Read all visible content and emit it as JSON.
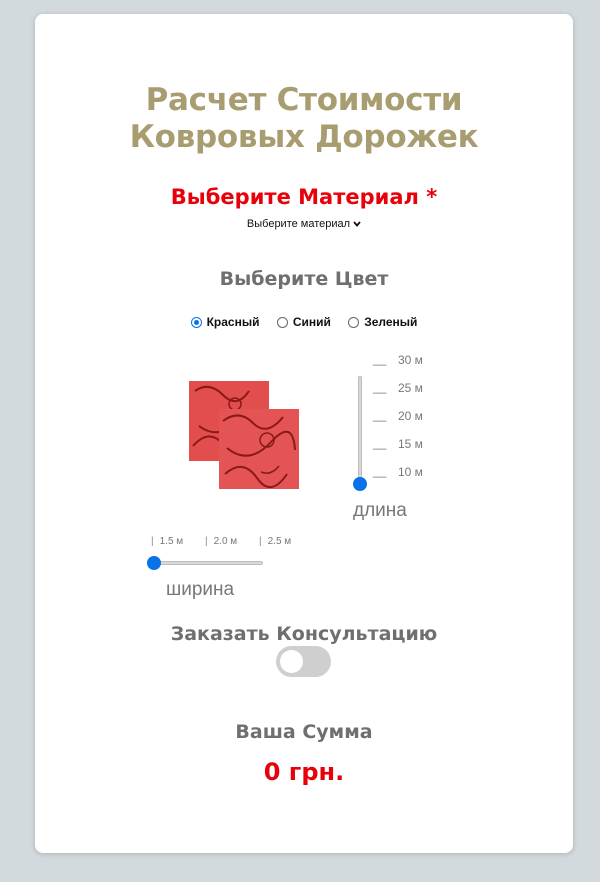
{
  "title_line1": "Расчет Стоимости",
  "title_line2": "Ковровых Дорожек",
  "material": {
    "label": "Выберите Материал *",
    "selected": "Выберите материал",
    "chevron_icon": "chevron-down-icon"
  },
  "color": {
    "label": "Выберите Цвет",
    "options": [
      {
        "label": "Красный",
        "checked": true
      },
      {
        "label": "Синий",
        "checked": false
      },
      {
        "label": "Зеленый",
        "checked": false
      }
    ],
    "swatch_color": "#e24d4d"
  },
  "length": {
    "ticks": [
      "30 м",
      "25 м",
      "20 м",
      "15 м",
      "10 м"
    ],
    "value": "10 м",
    "label": "длина"
  },
  "width": {
    "ticks": [
      "1.5 м",
      "2.0 м",
      "2.5 м"
    ],
    "value": "1.5 м",
    "label": "ширина"
  },
  "consultation": {
    "label": "Заказать Консультацию",
    "enabled": false
  },
  "total": {
    "label": "Ваша Сумма",
    "value": "0 грн."
  },
  "colors": {
    "accent": "#0a72e8",
    "title": "#a89d70",
    "red": "#e8000b"
  }
}
